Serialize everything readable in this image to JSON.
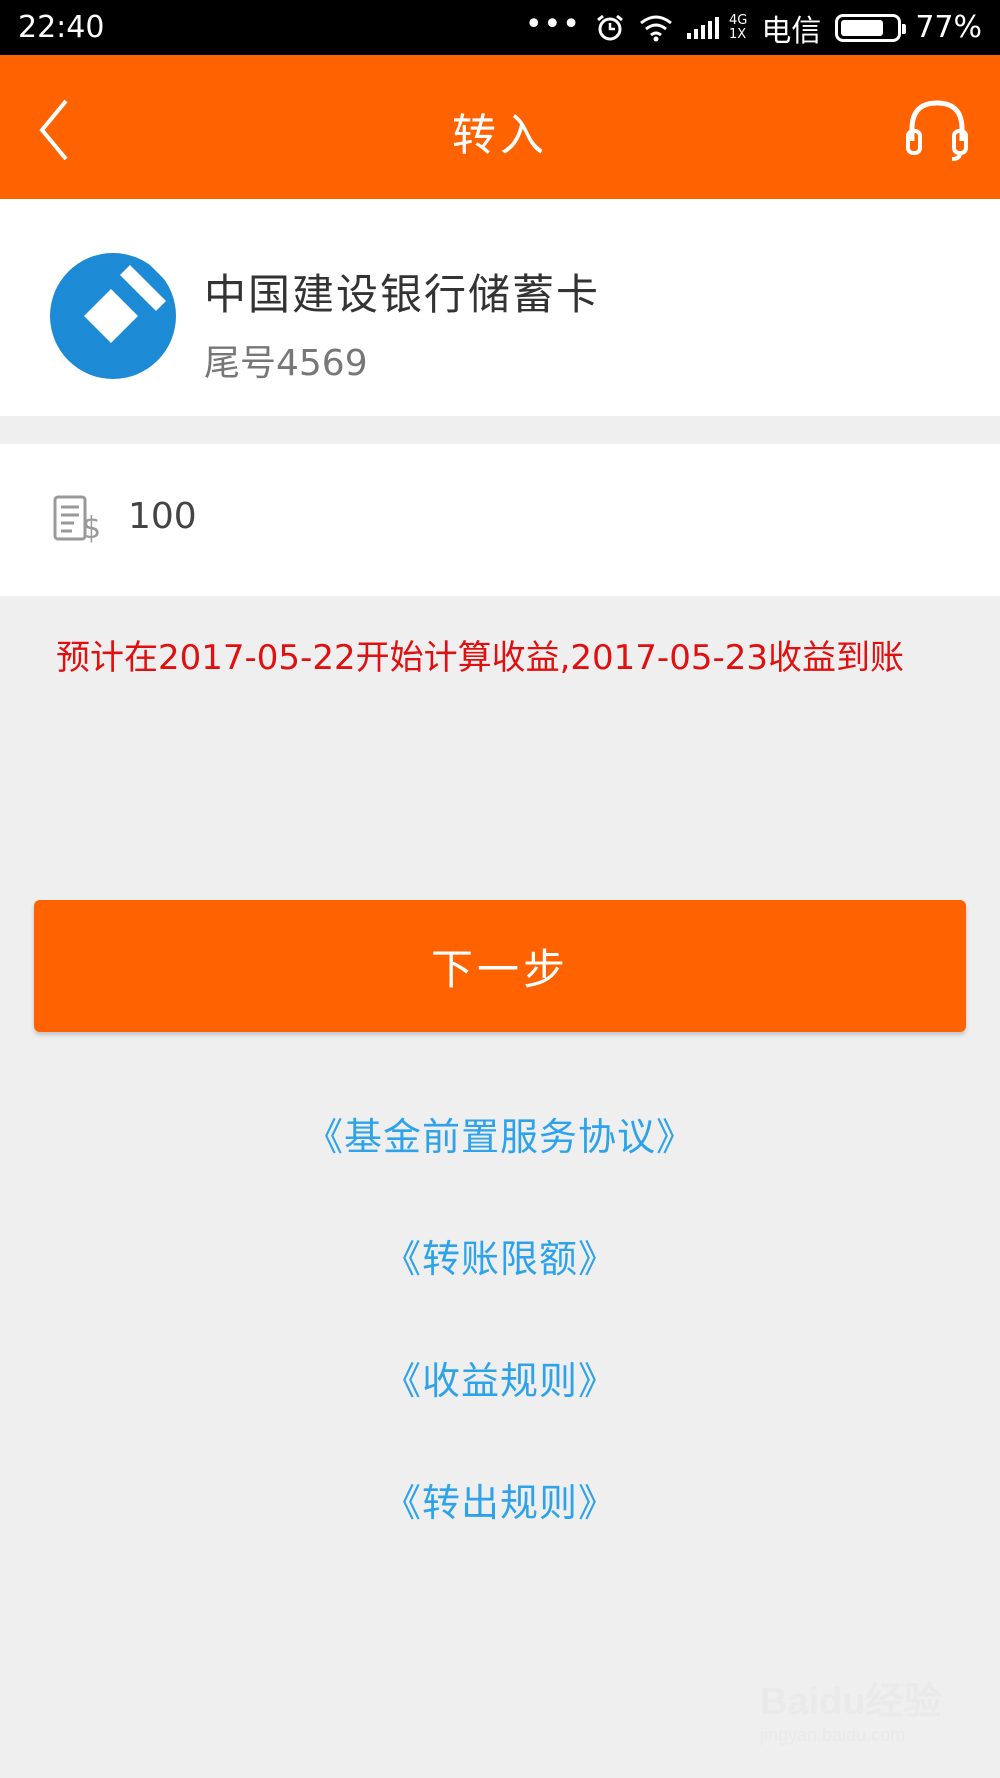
{
  "status_bar": {
    "time": "22:40",
    "signal_top": "4G",
    "signal_bottom": "1X",
    "carrier": "电信",
    "battery": "77%",
    "battery_level": 0.77
  },
  "header": {
    "title": "转入"
  },
  "bank_card": {
    "name": "中国建设银行储蓄卡",
    "tail": "尾号4569",
    "logo_color": "#1d8ad6"
  },
  "amount": {
    "value": "100"
  },
  "notice": {
    "text": "预计在2017-05-22开始计算收益,2017-05-23收益到账"
  },
  "actions": {
    "next_label": "下一步"
  },
  "links": [
    "《基金前置服务协议》",
    "《转账限额》",
    "《收益规则》",
    "《转出规则》"
  ],
  "watermark": {
    "main": "Baidu经验",
    "sub": "jingyan.baidu.com"
  },
  "colors": {
    "brand": "#ff6200",
    "link": "#2fa3ea",
    "notice": "#e01010"
  }
}
